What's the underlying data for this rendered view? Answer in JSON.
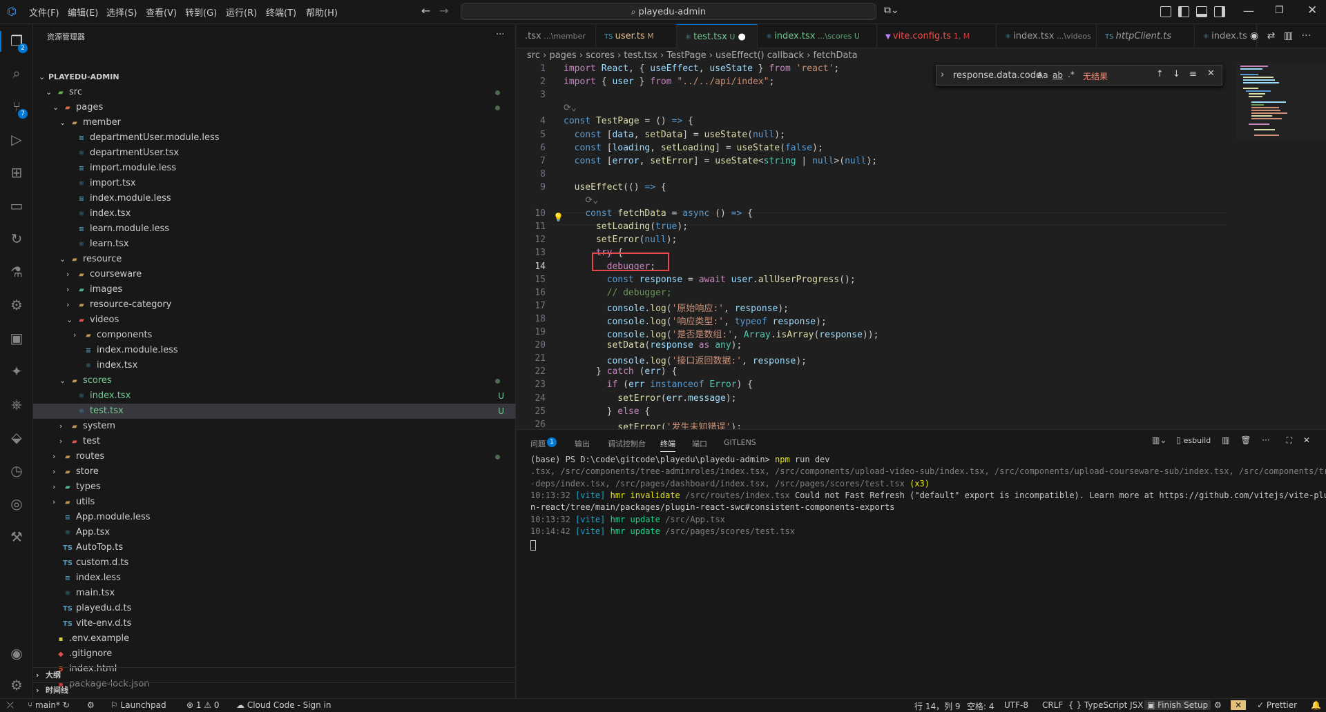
{
  "menu": [
    "文件(F)",
    "编辑(E)",
    "选择(S)",
    "查看(V)",
    "转到(G)",
    "运行(R)",
    "终端(T)",
    "帮助(H)"
  ],
  "command_center": "playedu-admin",
  "activity": {
    "explorer_badge": "2",
    "scm_badge": "7"
  },
  "sidebar": {
    "title": "资源管理器",
    "more": "···",
    "rows": [
      {
        "label": "PLAYEDU-ADMIN",
        "indent": 0,
        "tw": "⌄",
        "icon": "",
        "color": "#ccc",
        "bold": true
      },
      {
        "label": "src",
        "indent": 1,
        "tw": "⌄",
        "icon": "▰",
        "icolor": "#6aaf4f",
        "color": "#ccc",
        "dot": true
      },
      {
        "label": "pages",
        "indent": 2,
        "tw": "⌄",
        "icon": "▰",
        "icolor": "#e06c4f",
        "color": "#ccc",
        "dot": true
      },
      {
        "label": "member",
        "indent": 3,
        "tw": "⌄",
        "icon": "▰",
        "icolor": "#c09553",
        "color": "#ccc"
      },
      {
        "label": "departmentUser.module.less",
        "indent": 4,
        "icon": "≡",
        "icolor": "#519aba",
        "color": "#ccc"
      },
      {
        "label": "departmentUser.tsx",
        "indent": 4,
        "icon": "⚛",
        "icolor": "#519aba",
        "color": "#ccc"
      },
      {
        "label": "import.module.less",
        "indent": 4,
        "icon": "≡",
        "icolor": "#519aba",
        "color": "#ccc"
      },
      {
        "label": "import.tsx",
        "indent": 4,
        "icon": "⚛",
        "icolor": "#519aba",
        "color": "#ccc"
      },
      {
        "label": "index.module.less",
        "indent": 4,
        "icon": "≡",
        "icolor": "#519aba",
        "color": "#ccc"
      },
      {
        "label": "index.tsx",
        "indent": 4,
        "icon": "⚛",
        "icolor": "#519aba",
        "color": "#ccc"
      },
      {
        "label": "learn.module.less",
        "indent": 4,
        "icon": "≡",
        "icolor": "#519aba",
        "color": "#ccc"
      },
      {
        "label": "learn.tsx",
        "indent": 4,
        "icon": "⚛",
        "icolor": "#519aba",
        "color": "#ccc"
      },
      {
        "label": "resource",
        "indent": 3,
        "tw": "⌄",
        "icon": "▰",
        "icolor": "#c09553",
        "color": "#ccc"
      },
      {
        "label": "courseware",
        "indent": 4,
        "tw": "›",
        "icon": "▰",
        "icolor": "#c09553",
        "color": "#ccc"
      },
      {
        "label": "images",
        "indent": 4,
        "tw": "›",
        "icon": "▰",
        "icolor": "#4fb38a",
        "color": "#ccc"
      },
      {
        "label": "resource-category",
        "indent": 4,
        "tw": "›",
        "icon": "▰",
        "icolor": "#c09553",
        "color": "#ccc"
      },
      {
        "label": "videos",
        "indent": 4,
        "tw": "⌄",
        "icon": "▰",
        "icolor": "#e05252",
        "color": "#ccc"
      },
      {
        "label": "components",
        "indent": 5,
        "tw": "›",
        "icon": "▰",
        "icolor": "#c09553",
        "color": "#ccc"
      },
      {
        "label": "index.module.less",
        "indent": 5,
        "icon": "≡",
        "icolor": "#519aba",
        "color": "#ccc"
      },
      {
        "label": "index.tsx",
        "indent": 5,
        "icon": "⚛",
        "icolor": "#519aba",
        "color": "#ccc"
      },
      {
        "label": "scores",
        "indent": 3,
        "tw": "⌄",
        "icon": "▰",
        "icolor": "#c09553",
        "color": "#73c991",
        "dot": true
      },
      {
        "label": "index.tsx",
        "indent": 4,
        "icon": "⚛",
        "icolor": "#519aba",
        "color": "#73c991",
        "u": "U"
      },
      {
        "label": "test.tsx",
        "indent": 4,
        "icon": "⚛",
        "icolor": "#519aba",
        "color": "#73c991",
        "u": "U",
        "sel": true
      },
      {
        "label": "system",
        "indent": 3,
        "tw": "›",
        "icon": "▰",
        "icolor": "#c09553",
        "color": "#ccc"
      },
      {
        "label": "test",
        "indent": 3,
        "tw": "›",
        "icon": "▰",
        "icolor": "#e05252",
        "color": "#ccc"
      },
      {
        "label": "routes",
        "indent": 2,
        "tw": "›",
        "icon": "▰",
        "icolor": "#c09553",
        "color": "#ccc",
        "dot": true
      },
      {
        "label": "store",
        "indent": 2,
        "tw": "›",
        "icon": "▰",
        "icolor": "#c09553",
        "color": "#ccc"
      },
      {
        "label": "types",
        "indent": 2,
        "tw": "›",
        "icon": "▰",
        "icolor": "#4fb38a",
        "color": "#ccc"
      },
      {
        "label": "utils",
        "indent": 2,
        "tw": "›",
        "icon": "▰",
        "icolor": "#c09553",
        "color": "#ccc"
      },
      {
        "label": "App.module.less",
        "indent": 2,
        "icon": "≡",
        "icolor": "#519aba",
        "color": "#ccc"
      },
      {
        "label": "App.tsx",
        "indent": 2,
        "icon": "⚛",
        "icolor": "#519aba",
        "color": "#ccc"
      },
      {
        "label": "AutoTop.ts",
        "indent": 2,
        "icon": "TS",
        "icolor": "#519aba",
        "color": "#ccc"
      },
      {
        "label": "custom.d.ts",
        "indent": 2,
        "icon": "TS",
        "icolor": "#519aba",
        "color": "#ccc"
      },
      {
        "label": "index.less",
        "indent": 2,
        "icon": "≡",
        "icolor": "#519aba",
        "color": "#ccc"
      },
      {
        "label": "main.tsx",
        "indent": 2,
        "icon": "⚛",
        "icolor": "#519aba",
        "color": "#ccc"
      },
      {
        "label": "playedu.d.ts",
        "indent": 2,
        "icon": "TS",
        "icolor": "#519aba",
        "color": "#ccc"
      },
      {
        "label": "vite-env.d.ts",
        "indent": 2,
        "icon": "TS",
        "icolor": "#519aba",
        "color": "#ccc"
      },
      {
        "label": ".env.example",
        "indent": 1,
        "icon": "▪",
        "icolor": "#cbcb41",
        "color": "#ccc"
      },
      {
        "label": ".gitignore",
        "indent": 1,
        "icon": "◆",
        "icolor": "#e05252",
        "color": "#ccc"
      },
      {
        "label": "index.html",
        "indent": 1,
        "icon": "5",
        "icolor": "#e44d26",
        "color": "#ccc"
      },
      {
        "label": "package-lock.json",
        "indent": 1,
        "icon": "▪",
        "icolor": "#cb3837",
        "color": "#8b8b8b"
      }
    ],
    "outline": "大纲",
    "timeline": "时间线"
  },
  "tabs": [
    {
      "name": ".tsx",
      "desc": "...\\member",
      "color": "#9d9d9d",
      "icon": ""
    },
    {
      "name": "user.ts",
      "desc": "M",
      "color": "#e2c08d",
      "icon": "TS"
    },
    {
      "name": "test.tsx",
      "desc": "U",
      "color": "#73c991",
      "icon": "⚛",
      "active": true,
      "dirty": true
    },
    {
      "name": "index.tsx",
      "desc": "...\\scores U",
      "color": "#73c991",
      "icon": "⚛"
    },
    {
      "name": "vite.config.ts",
      "desc": "1, M",
      "color": "#f14c4c",
      "icon": "▼"
    },
    {
      "name": "index.tsx",
      "desc": "...\\videos",
      "color": "#9d9d9d",
      "icon": "⚛"
    },
    {
      "name": "httpClient.ts",
      "desc": "",
      "color": "#9d9d9d",
      "icon": "TS",
      "italic": true
    },
    {
      "name": "index.ts",
      "desc": "",
      "color": "#9d9d9d",
      "icon": "⚛"
    }
  ],
  "breadcrumb": [
    "src",
    "pages",
    "scores",
    "test.tsx",
    "TestPage",
    "useEffect() callback",
    "fetchData"
  ],
  "find": {
    "query": "response.data.code",
    "aa": "Aa",
    "ab": "ab",
    "re": ".*",
    "result": "无结果"
  },
  "code": [
    {
      "n": "1",
      "h": "<span class='c'>import</span> <span class='v'>React</span>, { <span class='v'>useEffect</span>, <span class='v'>useState</span> } <span class='c'>from</span> <span class='s'>'react'</span>;"
    },
    {
      "n": "2",
      "h": "<span class='c'>import</span> { <span class='v'>user</span> } <span class='c'>from</span> <span class='s'>\"../../api/index\"</span>;"
    },
    {
      "n": "3",
      "h": ""
    },
    {
      "n": "",
      "h": "<span class='gy'>⟳⌄</span>"
    },
    {
      "n": "4",
      "h": "<span class='k'>const</span> <span class='f'>TestPage</span> = () <span class='k'>=&gt;</span> {"
    },
    {
      "n": "5",
      "h": "  <span class='k'>const</span> [<span class='v'>data</span>, <span class='f'>setData</span>] = <span class='f'>useState</span>(<span class='k'>null</span>);"
    },
    {
      "n": "6",
      "h": "  <span class='k'>const</span> [<span class='v'>loading</span>, <span class='f'>setLoading</span>] = <span class='f'>useState</span>(<span class='k'>false</span>);"
    },
    {
      "n": "7",
      "h": "  <span class='k'>const</span> [<span class='v'>error</span>, <span class='f'>setError</span>] = <span class='f'>useState</span>&lt;<span class='t'>string</span> | <span class='k'>null</span>&gt;(<span class='k'>null</span>);"
    },
    {
      "n": "8",
      "h": ""
    },
    {
      "n": "9",
      "h": "  <span class='f'>useEffect</span>(() <span class='k'>=&gt;</span> {"
    },
    {
      "n": "",
      "h": "    <span class='gy'>⟳⌄</span>"
    },
    {
      "n": "10",
      "h": "    <span class='k'>const</span> <span class='f'>fetchData</span> = <span class='k'>async</span> () <span class='k'>=&gt;</span> {"
    },
    {
      "n": "11",
      "h": "      <span class='f'>setLoading</span>(<span class='k'>true</span>);"
    },
    {
      "n": "12",
      "h": "      <span class='f'>setError</span>(<span class='k'>null</span>);"
    },
    {
      "n": "13",
      "h": "      <span class='c'>try</span> {"
    },
    {
      "n": "14",
      "h": "        <span class='c'>debugger</span>;",
      "cur": true
    },
    {
      "n": "15",
      "h": "        <span class='k'>const</span> <span class='v'>response</span> = <span class='c'>await</span> <span class='v'>user</span>.<span class='f'>allUserProgress</span>();"
    },
    {
      "n": "16",
      "h": "        <span class='cm'>// debugger;</span>"
    },
    {
      "n": "17",
      "h": "        <span class='v'>console</span>.<span class='f'>log</span>(<span class='s'>'原始响应:'</span>, <span class='v'>response</span>);"
    },
    {
      "n": "18",
      "h": "        <span class='v'>console</span>.<span class='f'>log</span>(<span class='s'>'响应类型:'</span>, <span class='k'>typeof</span> <span class='v'>response</span>);"
    },
    {
      "n": "19",
      "h": "        <span class='v'>console</span>.<span class='f'>log</span>(<span class='s'>'是否是数组:'</span>, <span class='t'>Array</span>.<span class='f'>isArray</span>(<span class='v'>response</span>));"
    },
    {
      "n": "20",
      "h": "        <span class='f'>setData</span>(<span class='v'>response</span> <span class='c'>as</span> <span class='t'>any</span>);"
    },
    {
      "n": "21",
      "h": "        <span class='v'>console</span>.<span class='f'>log</span>(<span class='s'>'接口返回数据:'</span>, <span class='v'>response</span>);"
    },
    {
      "n": "22",
      "h": "      } <span class='c'>catch</span> (<span class='v'>err</span>) {"
    },
    {
      "n": "23",
      "h": "        <span class='c'>if</span> (<span class='v'>err</span> <span class='k'>instanceof</span> <span class='t'>Error</span>) {"
    },
    {
      "n": "24",
      "h": "          <span class='f'>setError</span>(<span class='v'>err</span>.<span class='v'>message</span>);"
    },
    {
      "n": "25",
      "h": "        } <span class='c'>else</span> {"
    },
    {
      "n": "26",
      "h": "          <span class='f'>setError</span>(<span class='s'>'发生未知错误'</span>);"
    }
  ],
  "panel": {
    "tabs": [
      "问题",
      "输出",
      "调试控制台",
      "终端",
      "端口",
      "GITLENS"
    ],
    "problems_badge": "1",
    "terminal_name": "esbuild",
    "lines": [
      "(base) PS D:\\code\\gitcode\\playedu\\playedu-admin> <span class='yl'>npm</span> run dev",
      "<span class='gy'>.tsx, /src/components/tree-adminroles/index.tsx, /src/components/upload-video-sub/index.tsx, /src/components/upload-courseware-sub/index.tsx, /src/components/tree</span>",
      "<span class='gy'>-deps/index.tsx, /src/pages/dashboard/index.tsx, /src/pages/scores/test.tsx</span> <span class='yl'>(x3)</span>",
      "<span class='gy'>10:13:32</span> <span class='cy'>[vite]</span> <span class='yl'>hmr invalidate</span> <span class='gy'>/src/routes/index.tsx</span> Could not Fast Refresh (\"default\" export is incompatible). Learn more at https://github.com/vitejs/vite-plugi",
      "n-react/tree/main/packages/plugin-react-swc#consistent-components-exports",
      "<span class='gy'>10:13:32</span> <span class='cy'>[vite]</span> <span class='gr'>hmr update</span> <span class='gy'>/src/App.tsx</span>",
      "<span class='gy'>10:14:42</span> <span class='cy'>[vite]</span> <span class='gr'>hmr update</span> <span class='gy'>/src/pages/scores/test.tsx</span>"
    ]
  },
  "status": {
    "branch": "main*",
    "launchpad": "Launchpad",
    "errors": "1",
    "warnings": "0",
    "cloud": "Cloud Code - Sign in",
    "position": "行 14，列 9",
    "spaces": "空格: 4",
    "encoding": "UTF-8",
    "eol": "CRLF",
    "language": "TypeScript JSX",
    "finish": "Finish Setup",
    "prettier": "Prettier"
  }
}
